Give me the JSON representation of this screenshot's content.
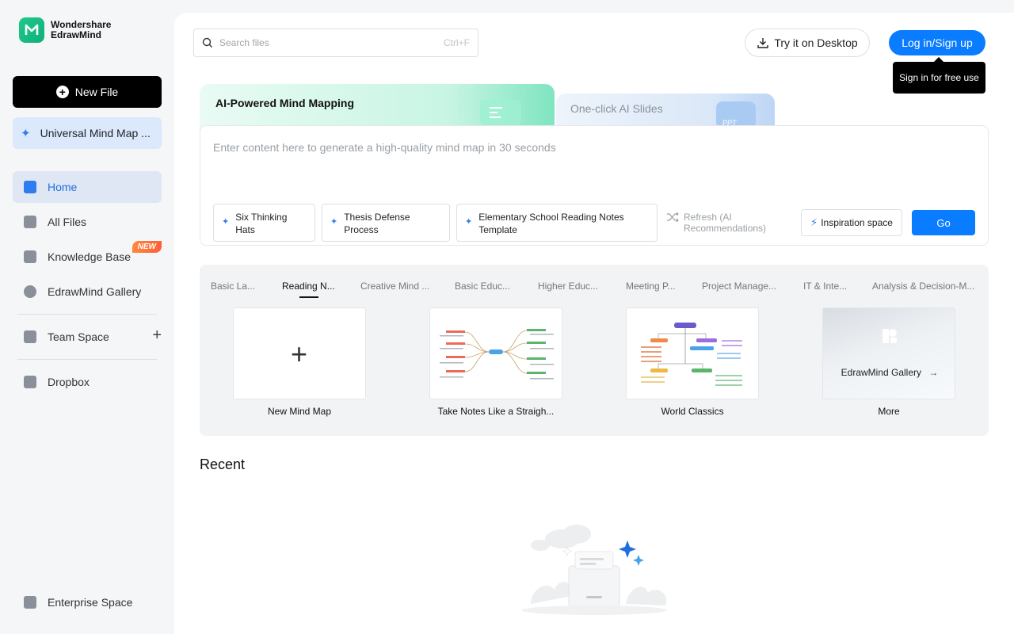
{
  "brand": {
    "line1": "Wondershare",
    "line2": "EdrawMind",
    "logo_icon": "edrawmind-logo-icon",
    "accent": "#0a7cff"
  },
  "sidebar": {
    "new_file": "New File",
    "universal": "Universal Mind Map ...",
    "items": [
      {
        "label": "Home",
        "icon": "home-icon",
        "active": true
      },
      {
        "label": "All Files",
        "icon": "file-icon"
      },
      {
        "label": "Knowledge Base",
        "icon": "book-icon",
        "badge": "NEW"
      },
      {
        "label": "EdrawMind Gallery",
        "icon": "gallery-icon"
      },
      {
        "label": "Team Space",
        "icon": "team-icon"
      },
      {
        "label": "Dropbox",
        "icon": "dropbox-icon"
      },
      {
        "label": "Enterprise Space",
        "icon": "enterprise-icon"
      }
    ]
  },
  "header": {
    "search_placeholder": "Search files",
    "search_shortcut": "Ctrl+F",
    "desktop_button": "Try it on Desktop",
    "login_button": "Log in/Sign up",
    "tooltip": "Sign in for free use"
  },
  "ai": {
    "tab_mindmap": "AI-Powered Mind Mapping",
    "tab_slides": "One-click AI Slides",
    "slides_badge": "PPT",
    "placeholder": "Enter content here to generate a high-quality mind map in 30 seconds",
    "chips": [
      "Six Thinking Hats",
      "Thesis Defense Process",
      "Elementary School Reading Notes Template"
    ],
    "refresh": "Refresh (AI Recommendations)",
    "inspiration": "Inspiration space",
    "go": "Go"
  },
  "templates": {
    "categories": [
      "Basic La...",
      "Reading N...",
      "Creative Mind ...",
      "Basic Educ...",
      "Higher Educ...",
      "Meeting P...",
      "Project Manage...",
      "IT & Inte...",
      "Analysis & Decision-M..."
    ],
    "active_category": "Reading N...",
    "cards": [
      "New Mind Map",
      "Take Notes Like a Straigh...",
      "World Classics",
      "More"
    ],
    "gallery_overlay": "EdrawMind Gallery"
  },
  "recent": {
    "title": "Recent"
  }
}
